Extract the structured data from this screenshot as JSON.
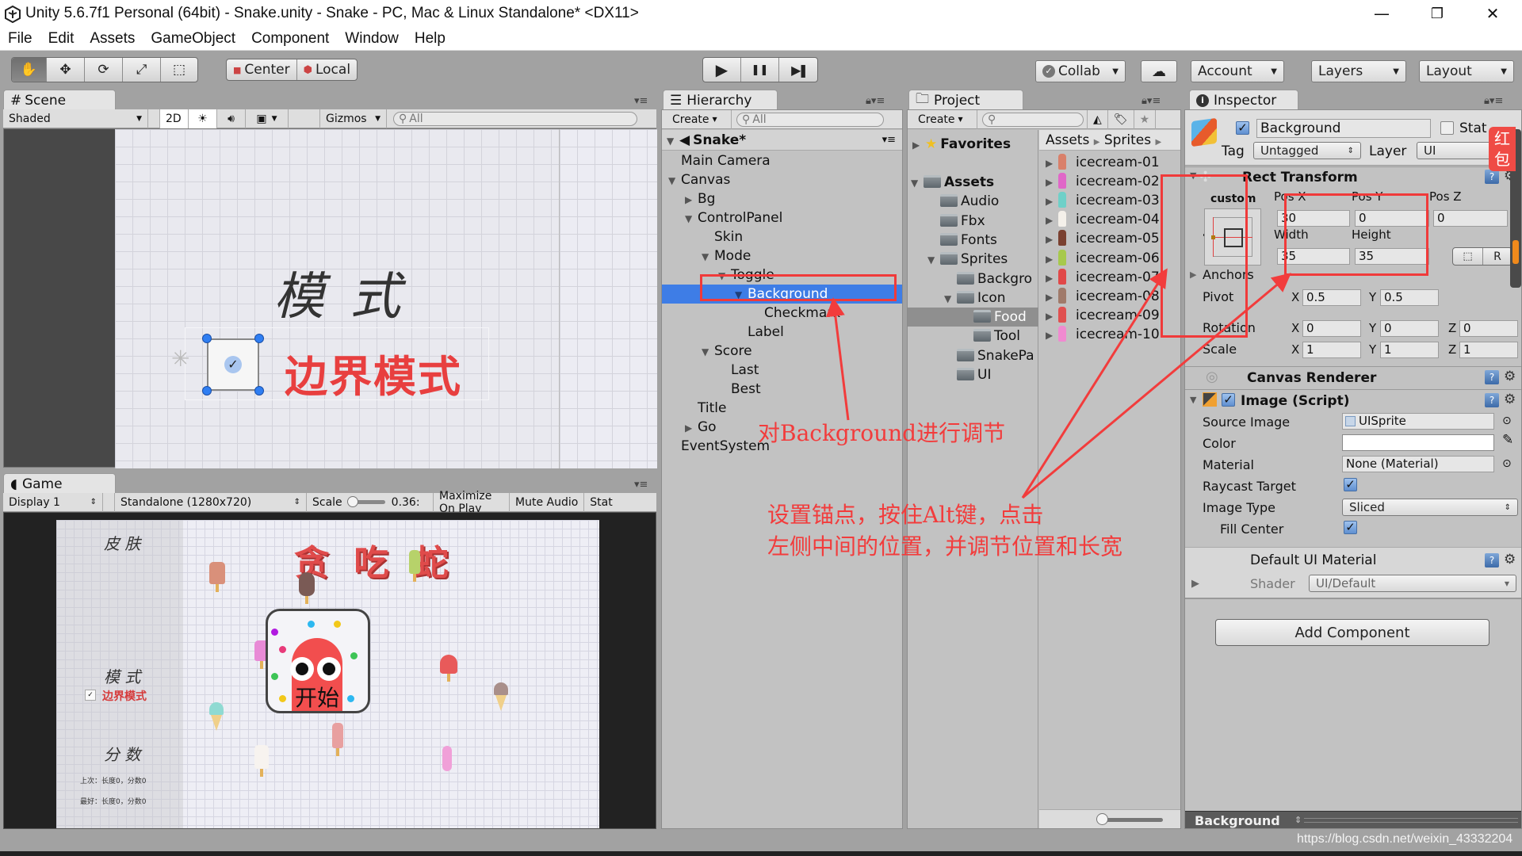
{
  "window": {
    "title": "Unity 5.6.7f1 Personal (64bit) - Snake.unity - Snake - PC, Mac & Linux Standalone* <DX11>",
    "controls": {
      "minimize": "—",
      "restore": "❐",
      "close": "✕"
    }
  },
  "menu": [
    "File",
    "Edit",
    "Assets",
    "GameObject",
    "Component",
    "Window",
    "Help"
  ],
  "toolbar": {
    "tools": [
      {
        "name": "hand-tool",
        "glyph": "✋",
        "active": true
      },
      {
        "name": "move-tool",
        "glyph": "✥",
        "active": false
      },
      {
        "name": "rotate-tool",
        "glyph": "⟳",
        "active": false
      },
      {
        "name": "scale-tool",
        "glyph": "⤢",
        "active": false
      },
      {
        "name": "rect-tool",
        "glyph": "⬚",
        "active": false
      }
    ],
    "pivot_center": "Center",
    "pivot_local": "Local",
    "play": "▶",
    "pause": "❚❚",
    "step": "▶❚",
    "collab": "Collab",
    "account": "Account",
    "layers": "Layers",
    "layout": "Layout"
  },
  "scene": {
    "tab": "Scene",
    "shading": "Shaded",
    "mode_2d": "2D",
    "gizmos": "Gizmos",
    "search_placeholder": "All",
    "mode_title": "模 式",
    "toggle_label": "边界模式"
  },
  "game": {
    "tab": "Game",
    "display": "Display 1",
    "resolution": "Standalone (1280x720)",
    "scale_label": "Scale",
    "scale_value": "0.36:",
    "maximize": "Maximize On Play",
    "mute": "Mute Audio",
    "stats": "Stat",
    "title": "贪 吃 蛇",
    "skin_label": "皮 肤",
    "mode_label": "模 式",
    "toggle_label": "边界模式",
    "score_label": "分 数",
    "last_score": "上次：长度0，分数0",
    "best_score": "最好：长度0，分数0",
    "start": "开始"
  },
  "hierarchy": {
    "tab": "Hierarchy",
    "create": "Create",
    "search_placeholder": "All",
    "scene_name": "Snake*",
    "items": [
      {
        "label": "Main Camera",
        "depth": 1,
        "arrow": ""
      },
      {
        "label": "Canvas",
        "depth": 1,
        "arrow": "▼"
      },
      {
        "label": "Bg",
        "depth": 2,
        "arrow": "▶"
      },
      {
        "label": "ControlPanel",
        "depth": 2,
        "arrow": "▼"
      },
      {
        "label": "Skin",
        "depth": 3,
        "arrow": ""
      },
      {
        "label": "Mode",
        "depth": 3,
        "arrow": "▼"
      },
      {
        "label": "Toggle",
        "depth": 4,
        "arrow": "▼"
      },
      {
        "label": "Background",
        "depth": 5,
        "arrow": "▼",
        "selected": true
      },
      {
        "label": "Checkmark",
        "depth": 6,
        "arrow": ""
      },
      {
        "label": "Label",
        "depth": 5,
        "arrow": ""
      },
      {
        "label": "Score",
        "depth": 3,
        "arrow": "▼"
      },
      {
        "label": "Last",
        "depth": 4,
        "arrow": ""
      },
      {
        "label": "Best",
        "depth": 4,
        "arrow": ""
      },
      {
        "label": "Title",
        "depth": 2,
        "arrow": ""
      },
      {
        "label": "Go",
        "depth": 2,
        "arrow": "▶"
      },
      {
        "label": "EventSystem",
        "depth": 1,
        "arrow": ""
      }
    ]
  },
  "project": {
    "tab": "Project",
    "create": "Create",
    "favorites": "Favorites",
    "breadcrumb": [
      "Assets",
      "Sprites"
    ],
    "tree": [
      {
        "label": "Assets",
        "depth": 0,
        "arrow": "▼",
        "bold": true
      },
      {
        "label": "Audio",
        "depth": 1,
        "arrow": ""
      },
      {
        "label": "Fbx",
        "depth": 1,
        "arrow": ""
      },
      {
        "label": "Fonts",
        "depth": 1,
        "arrow": ""
      },
      {
        "label": "Sprites",
        "depth": 1,
        "arrow": "▼"
      },
      {
        "label": "Backgro",
        "depth": 2,
        "arrow": ""
      },
      {
        "label": "Icon",
        "depth": 2,
        "arrow": "▼"
      },
      {
        "label": "Food",
        "depth": 3,
        "arrow": "",
        "selected": true
      },
      {
        "label": "Tool",
        "depth": 3,
        "arrow": ""
      },
      {
        "label": "SnakePa",
        "depth": 2,
        "arrow": ""
      },
      {
        "label": "UI",
        "depth": 2,
        "arrow": ""
      }
    ],
    "files": [
      {
        "label": "icecream-01",
        "color": "#d9806a"
      },
      {
        "label": "icecream-02",
        "color": "#e067c8"
      },
      {
        "label": "icecream-03",
        "color": "#6fd0c8"
      },
      {
        "label": "icecream-04",
        "color": "#f4f0ea"
      },
      {
        "label": "icecream-05",
        "color": "#7a4030"
      },
      {
        "label": "icecream-06",
        "color": "#a7c94c"
      },
      {
        "label": "icecream-07",
        "color": "#e14848"
      },
      {
        "label": "icecream-08",
        "color": "#a07a6a"
      },
      {
        "label": "icecream-09",
        "color": "#e05050"
      },
      {
        "label": "icecream-10",
        "color": "#f08ad0"
      }
    ]
  },
  "inspector": {
    "tab": "Inspector",
    "object_name": "Background",
    "active": true,
    "static_label": "Stat",
    "tag_label": "Tag",
    "tag_value": "Untagged",
    "layer_label": "Layer",
    "layer_value": "UI",
    "rect_transform": {
      "title": "Rect Transform",
      "anchor_preset_h": "custom",
      "anchor_preset_v": "custom",
      "pos_x_label": "Pos X",
      "pos_x": "30",
      "pos_y_label": "Pos Y",
      "pos_y": "0",
      "pos_z_label": "Pos Z",
      "pos_z": "0",
      "width_label": "Width",
      "width": "35",
      "height_label": "Height",
      "height": "35",
      "raw_edit": "R",
      "anchors_label": "Anchors",
      "pivot_label": "Pivot",
      "pivot_x": "0.5",
      "pivot_y": "0.5",
      "rotation_label": "Rotation",
      "rot_x": "0",
      "rot_y": "0",
      "rot_z": "0",
      "scale_label": "Scale",
      "scale_x": "1",
      "scale_y": "1",
      "scale_z": "1"
    },
    "canvas_renderer": "Canvas Renderer",
    "image": {
      "title": "Image (Script)",
      "source_image_label": "Source Image",
      "source_image": "UISprite",
      "color_label": "Color",
      "material_label": "Material",
      "material": "None (Material)",
      "raycast_label": "Raycast Target",
      "raycast": true,
      "image_type_label": "Image Type",
      "image_type": "Sliced",
      "fill_center_label": "Fill Center",
      "fill_center": true
    },
    "material": {
      "title": "Default UI Material",
      "shader_label": "Shader",
      "shader": "UI/Default"
    },
    "add_component": "Add Component",
    "preview_label": "Background"
  },
  "badge": {
    "line1": "红",
    "line2": "包"
  },
  "annotations": {
    "note1": "对Background进行调节",
    "note2_line1": "设置锚点，按住Alt键，点击",
    "note2_line2": "左侧中间的位置，并调节位置和长宽",
    "color": "#f23c3c"
  },
  "watermark": "https://blog.csdn.net/weixin_43332204"
}
